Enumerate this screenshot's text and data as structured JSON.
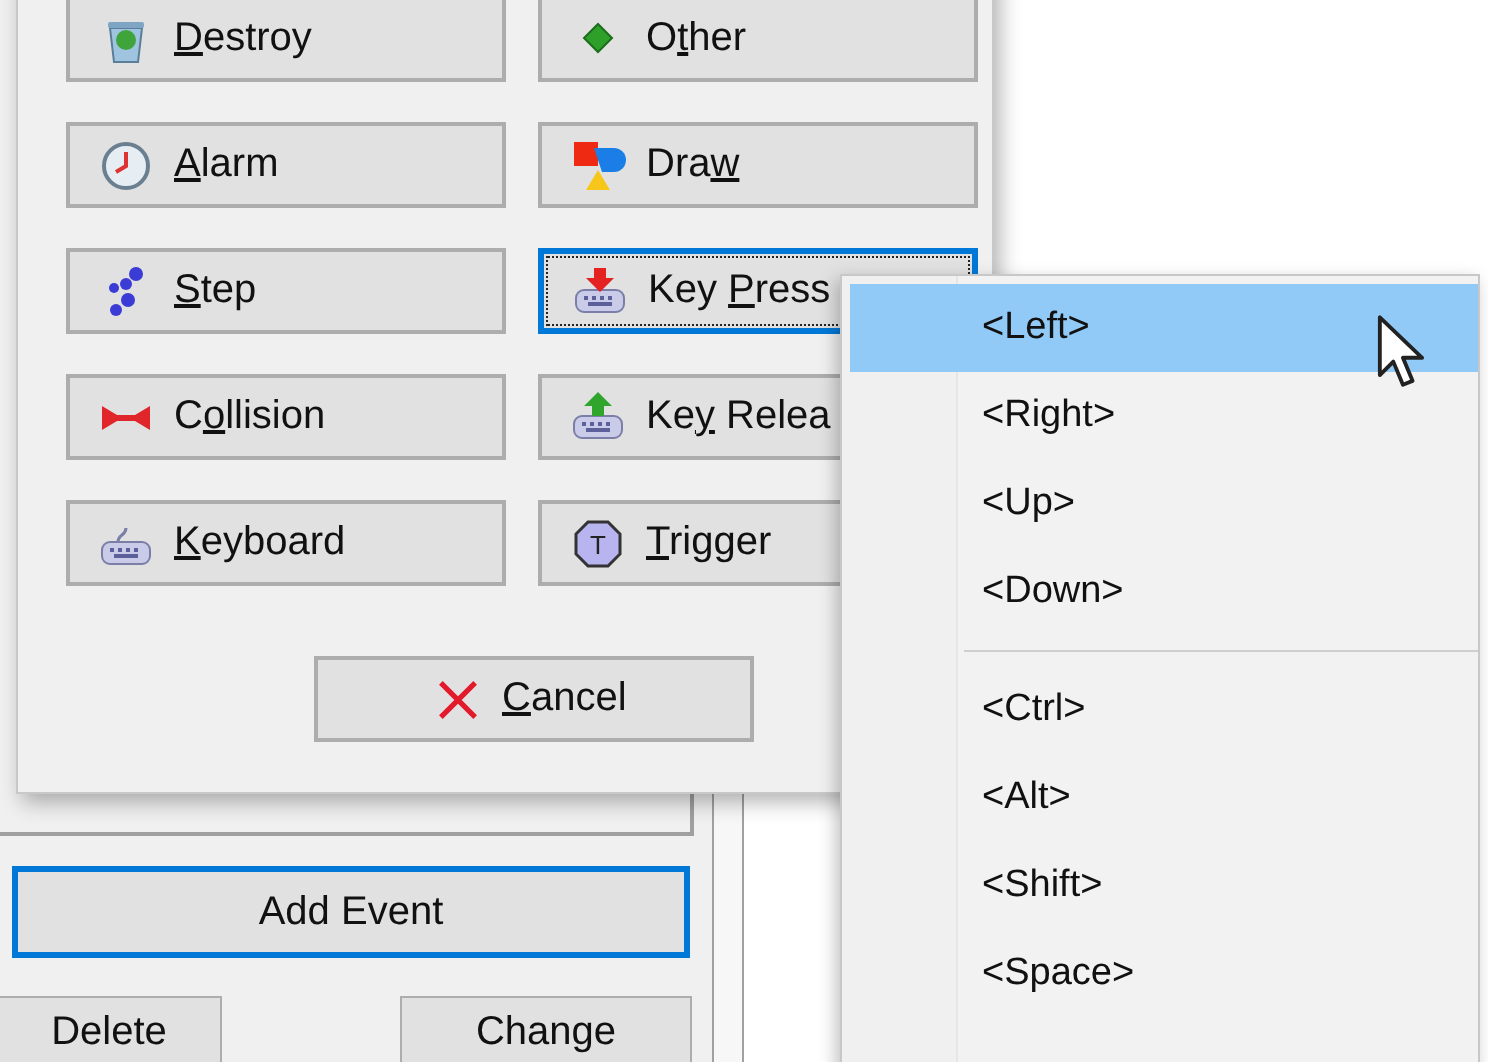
{
  "dialog": {
    "buttons": [
      {
        "kind": "destroy",
        "underlined": "D",
        "text_after": "estroy",
        "focused": false
      },
      {
        "kind": "other",
        "text_before": "O",
        "underlined": "t",
        "text_after": "her",
        "focused": false
      },
      {
        "kind": "alarm",
        "underlined": "A",
        "text_after": "larm",
        "focused": false
      },
      {
        "kind": "draw",
        "text_before": "Dra",
        "underlined": "w",
        "focused": false
      },
      {
        "kind": "step",
        "underlined": "S",
        "text_after": "tep",
        "focused": false
      },
      {
        "kind": "key_press",
        "text_before": "Key ",
        "underlined": "P",
        "text_after": "ress",
        "focused": true
      },
      {
        "kind": "collision",
        "text_before": "C",
        "underlined": "o",
        "text_after": "llision",
        "focused": false
      },
      {
        "kind": "key_release",
        "text_before": "Ke",
        "underlined": "y",
        "text_after": " Relea",
        "focused": false
      },
      {
        "kind": "keyboard",
        "underlined": "K",
        "text_after": "eyboard",
        "focused": false
      },
      {
        "kind": "trigger",
        "underlined": "T",
        "text_after": "rigger",
        "focused": false,
        "icon_text": "T"
      }
    ],
    "cancel": {
      "underlined": "C",
      "text_after": "ancel"
    }
  },
  "event_panel": {
    "add_button": {
      "label": "Add Event",
      "focused": true
    },
    "buttons": [
      {
        "label": "Delete",
        "focused": false
      },
      {
        "label": "Change",
        "focused": false
      }
    ]
  },
  "menu": {
    "items": [
      {
        "kind": "item",
        "label": "<Left>",
        "selected": true
      },
      {
        "kind": "item",
        "label": "<Right>",
        "selected": false
      },
      {
        "kind": "item",
        "label": "<Up>",
        "selected": false
      },
      {
        "kind": "item",
        "label": "<Down>",
        "selected": false
      },
      {
        "kind": "separator"
      },
      {
        "kind": "item",
        "label": "<Ctrl>",
        "selected": false
      },
      {
        "kind": "item",
        "label": "<Alt>",
        "selected": false
      },
      {
        "kind": "item",
        "label": "<Shift>",
        "selected": false
      },
      {
        "kind": "item",
        "label": "<Space>",
        "selected": false
      }
    ]
  }
}
